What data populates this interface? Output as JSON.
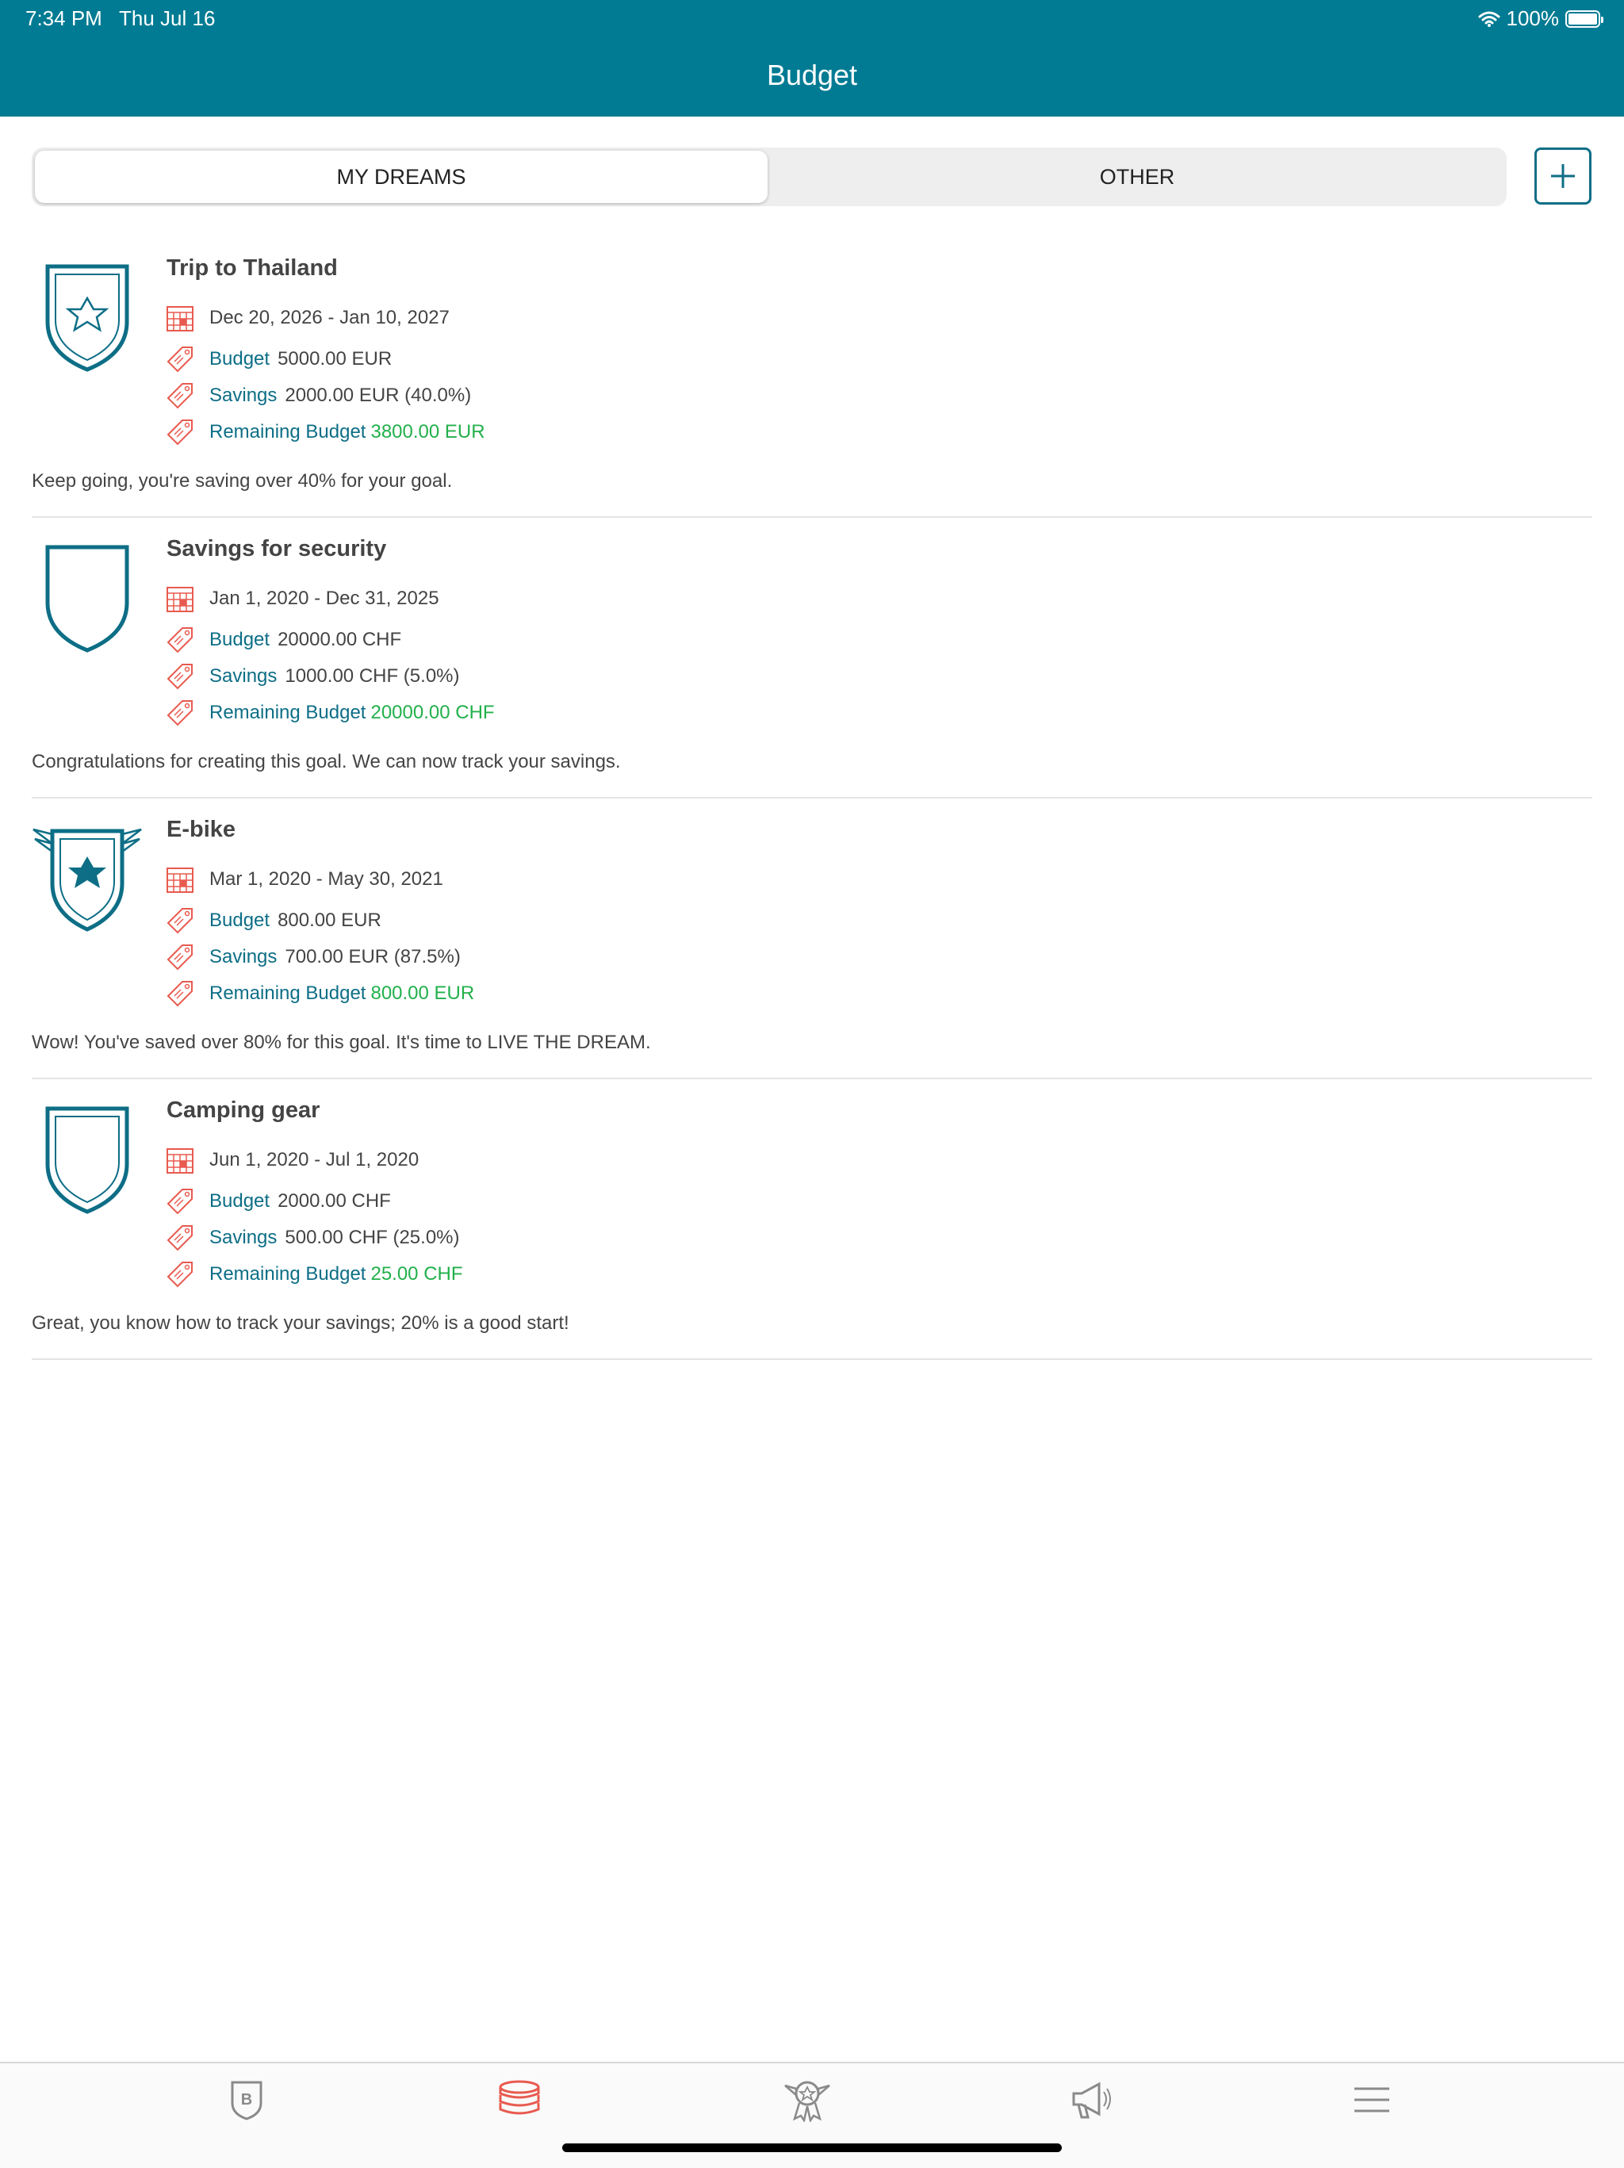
{
  "status": {
    "time": "7:34 PM",
    "date": "Thu Jul 16",
    "battery": "100%"
  },
  "header": {
    "title": "Budget"
  },
  "tabs": [
    {
      "label": "MY DREAMS",
      "active": true
    },
    {
      "label": "OTHER",
      "active": false
    }
  ],
  "colors": {
    "accent": "#007b93",
    "label": "#0d6e86",
    "positive": "#22b04b",
    "icon_red": "#e85a4f"
  },
  "goals": [
    {
      "title": "Trip to Thailand",
      "badge": "shield-star-outline-icon",
      "dates": "Dec 20, 2026 - Jan 10, 2027",
      "budget_label": "Budget",
      "budget": "5000.00 EUR",
      "savings_label": "Savings",
      "savings": "2000.00 EUR (40.0%)",
      "remaining_label": "Remaining Budget",
      "remaining": "3800.00 EUR",
      "message": "Keep going, you're saving over 40% for your goal."
    },
    {
      "title": "Savings for security",
      "badge": "shield-plain-icon",
      "dates": "Jan 1, 2020 - Dec 31, 2025",
      "budget_label": "Budget",
      "budget": "20000.00 CHF",
      "savings_label": "Savings",
      "savings": "1000.00 CHF (5.0%)",
      "remaining_label": "Remaining Budget",
      "remaining": "20000.00 CHF",
      "message": "Congratulations for creating this goal. We can now track your savings."
    },
    {
      "title": "E-bike",
      "badge": "winged-shield-star-icon",
      "dates": "Mar 1, 2020 - May 30, 2021",
      "budget_label": "Budget",
      "budget": "800.00 EUR",
      "savings_label": "Savings",
      "savings": "700.00 EUR (87.5%)",
      "remaining_label": "Remaining Budget",
      "remaining": "800.00 EUR",
      "message": "Wow! You've saved over 80% for this goal. It's time to LIVE THE DREAM."
    },
    {
      "title": "Camping gear",
      "badge": "shield-double-outline-icon",
      "dates": "Jun 1, 2020 - Jul 1, 2020",
      "budget_label": "Budget",
      "budget": "2000.00 CHF",
      "savings_label": "Savings",
      "savings": "500.00 CHF (25.0%)",
      "remaining_label": "Remaining Budget",
      "remaining": "25.00 CHF",
      "message": "Great, you know how to track your savings; 20% is a good start!"
    }
  ],
  "tabbar": [
    {
      "icon": "brand-shield-icon",
      "active": false
    },
    {
      "icon": "coins-stack-icon",
      "active": true
    },
    {
      "icon": "award-badge-icon",
      "active": false
    },
    {
      "icon": "megaphone-icon",
      "active": false
    },
    {
      "icon": "menu-icon",
      "active": false
    }
  ]
}
